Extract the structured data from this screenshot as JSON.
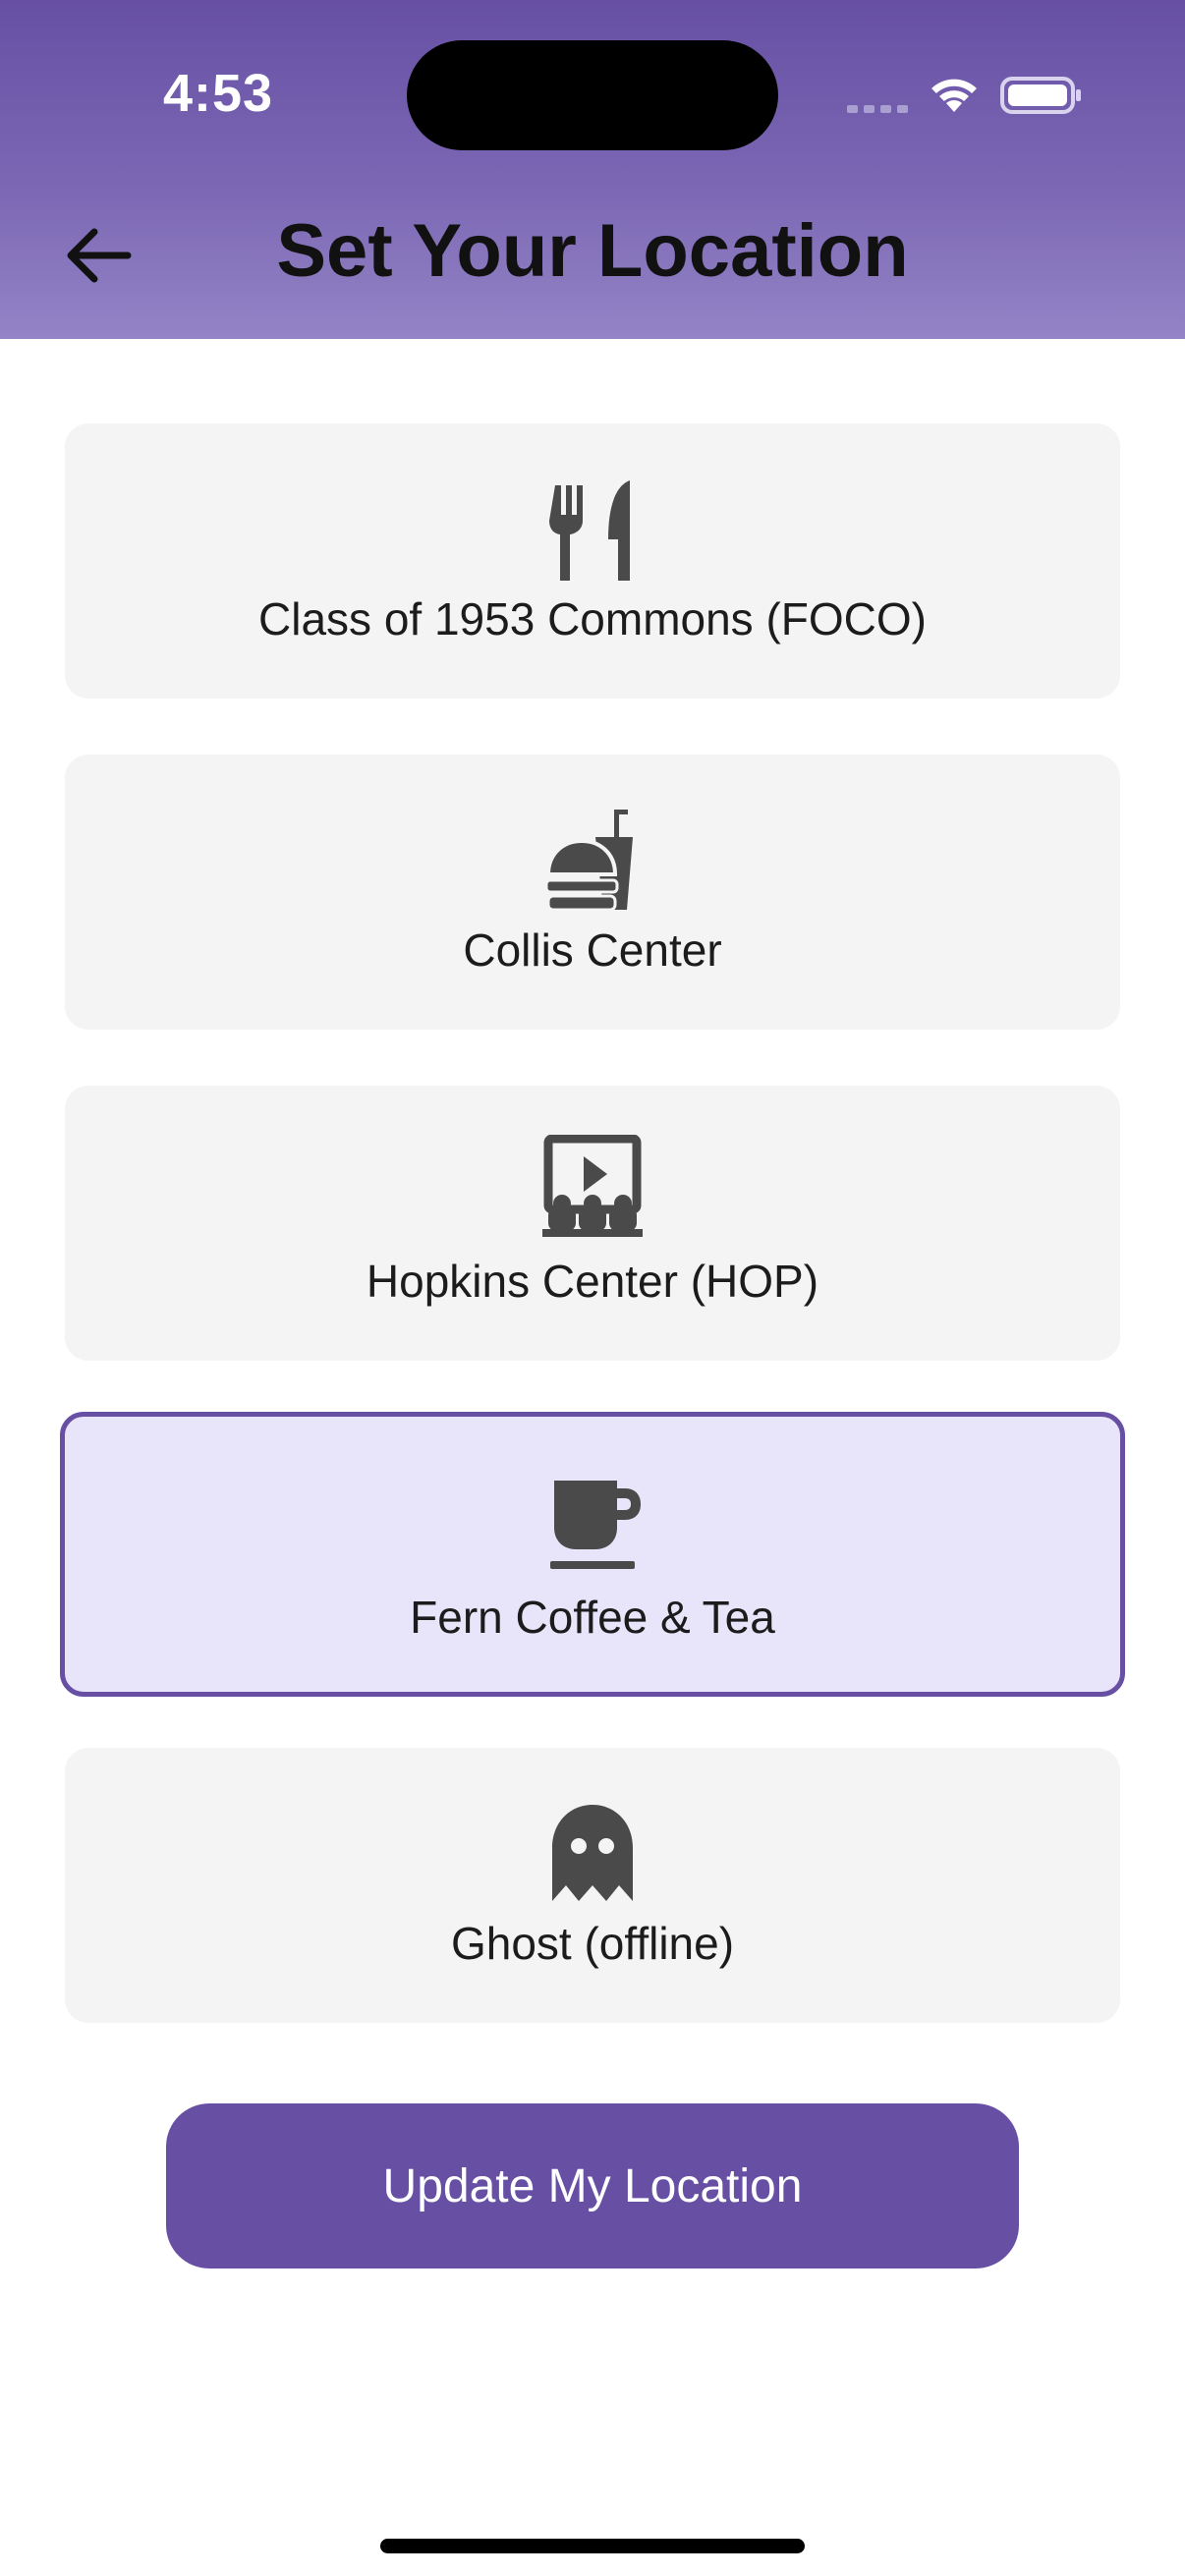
{
  "status_bar": {
    "time": "4:53",
    "icons": [
      "cellular-signal-icon",
      "wifi-icon",
      "battery-icon"
    ]
  },
  "header": {
    "title": "Set Your Location",
    "back_icon": "arrow-left-icon"
  },
  "locations": [
    {
      "label": "Class of 1953 Commons (FOCO)",
      "icon": "utensils-icon",
      "selected": false
    },
    {
      "label": "Collis Center",
      "icon": "burger-soda-icon",
      "selected": false
    },
    {
      "label": "Hopkins Center (HOP)",
      "icon": "theater-icon",
      "selected": false
    },
    {
      "label": "Fern Coffee & Tea",
      "icon": "coffee-mug-icon",
      "selected": true
    },
    {
      "label": "Ghost (offline)",
      "icon": "ghost-icon",
      "selected": false
    }
  ],
  "actions": {
    "update_label": "Update My Location"
  },
  "colors": {
    "accent": "#6750a4",
    "selected_background": "#e8e5fb",
    "card_background": "#f4f4f4",
    "icon": "#4a4a4a"
  }
}
